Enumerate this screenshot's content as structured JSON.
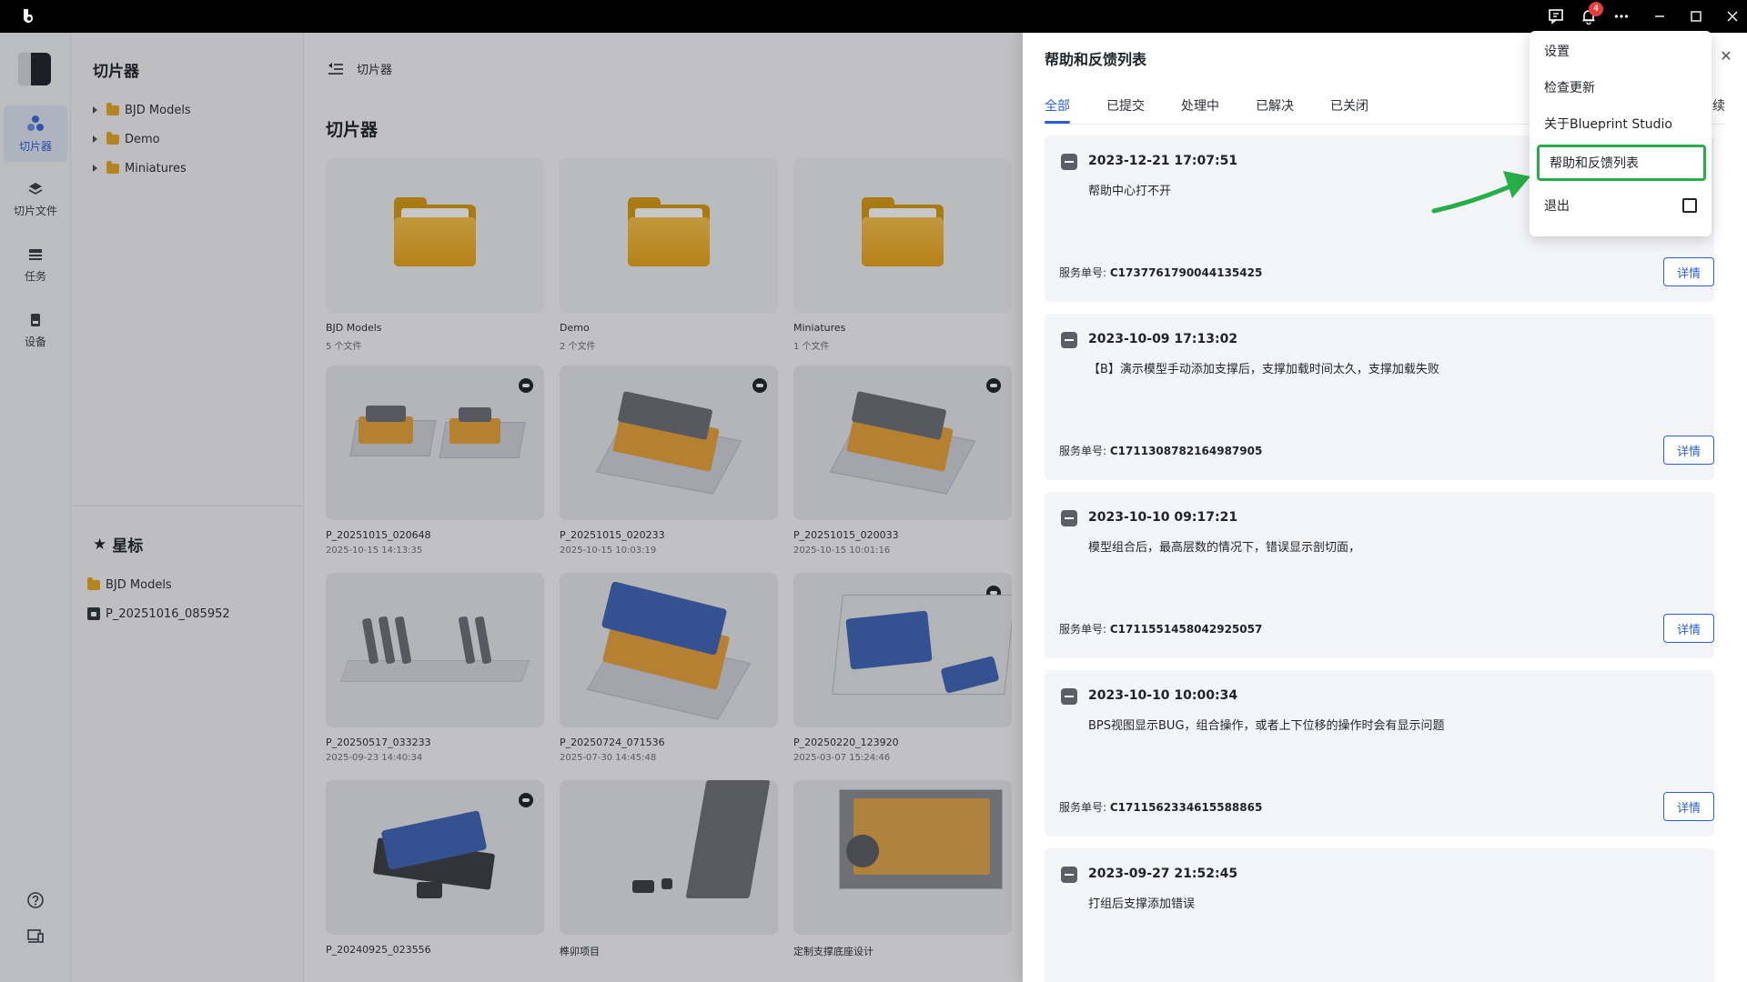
{
  "titlebar": {
    "notification_count": "4",
    "icons": [
      "app-logo",
      "feedback-icon",
      "bell-icon",
      "more-icon",
      "minimize-icon",
      "maximize-icon",
      "close-icon"
    ]
  },
  "nav": {
    "items": [
      {
        "label": "切片器",
        "icon": "slicer-icon",
        "active": true
      },
      {
        "label": "切片文件",
        "icon": "layers-icon",
        "active": false
      },
      {
        "label": "任务",
        "icon": "tasks-icon",
        "active": false
      },
      {
        "label": "设备",
        "icon": "device-icon",
        "active": false
      }
    ],
    "bottom_icons": [
      "help-icon",
      "devices-icon"
    ]
  },
  "tree": {
    "title": "切片器",
    "folders": [
      "BJD Models",
      "Demo",
      "Miniatures"
    ],
    "starred_title": "星标",
    "starred": [
      "BJD Models",
      "P_20251016_085952"
    ]
  },
  "main": {
    "breadcrumb": "切片器",
    "title": "切片器",
    "cards": [
      {
        "name": "BJD Models",
        "sub": "5 个文件",
        "kind": "folder"
      },
      {
        "name": "Demo",
        "sub": "2 个文件",
        "kind": "folder"
      },
      {
        "name": "Miniatures",
        "sub": "1 个文件",
        "kind": "folder"
      },
      {
        "name": "P_20251015_020648",
        "sub": "2025-10-15 14:13:35",
        "kind": "file"
      },
      {
        "name": "P_20251015_020233",
        "sub": "2025-10-15 10:03:19",
        "kind": "file"
      },
      {
        "name": "P_20251015_020033",
        "sub": "2025-10-15 10:01:16",
        "kind": "file"
      },
      {
        "name": "P_20250517_033233",
        "sub": "2025-09-23 14:40:34",
        "kind": "file"
      },
      {
        "name": "P_20250724_071536",
        "sub": "2025-07-30 14:45:48",
        "kind": "file"
      },
      {
        "name": "P_20250220_123920",
        "sub": "2025-03-07 15:24:46",
        "kind": "file"
      },
      {
        "name": "P_20240925_023556",
        "sub": "",
        "kind": "file"
      },
      {
        "name": "榫卯项目",
        "sub": "",
        "kind": "file"
      },
      {
        "name": "定制支撑底座设计",
        "sub": "",
        "kind": "file"
      }
    ]
  },
  "panel": {
    "title": "帮助和反馈列表",
    "tabs": [
      "全部",
      "已提交",
      "处理中",
      "已解决",
      "已关闭"
    ],
    "tab_extra": "续",
    "sn_label": "服务单号:",
    "detail_label": "详情",
    "tickets": [
      {
        "time": "2023-12-21 17:07:51",
        "desc": "帮助中心打不开",
        "sn": "C1737761790044135425"
      },
      {
        "time": "2023-10-09 17:13:02",
        "desc": "【B】演示模型手动添加支撑后，支撑加载时间太久，支撑加载失败",
        "sn": "C1711308782164987905"
      },
      {
        "time": "2023-10-10 09:17:21",
        "desc": "模型组合后，最高层数的情况下，错误显示剖切面，",
        "sn": "C1711551458042925057"
      },
      {
        "time": "2023-10-10 10:00:34",
        "desc": "BPS视图显示BUG，组合操作，或者上下位移的操作时会有显示问题",
        "sn": "C1711562334615588865"
      },
      {
        "time": "2023-09-27 21:52:45",
        "desc": "打组后支撑添加错误",
        "sn": ""
      }
    ]
  },
  "dropdown": {
    "items": [
      "设置",
      "检查更新",
      "关于Blueprint Studio",
      "帮助和反馈列表",
      "退出"
    ],
    "highlight_color": "#27ae48"
  },
  "colors": {
    "accent": "#2b5fd9",
    "highlight": "#27ae48",
    "badge": "#e53e3e"
  }
}
